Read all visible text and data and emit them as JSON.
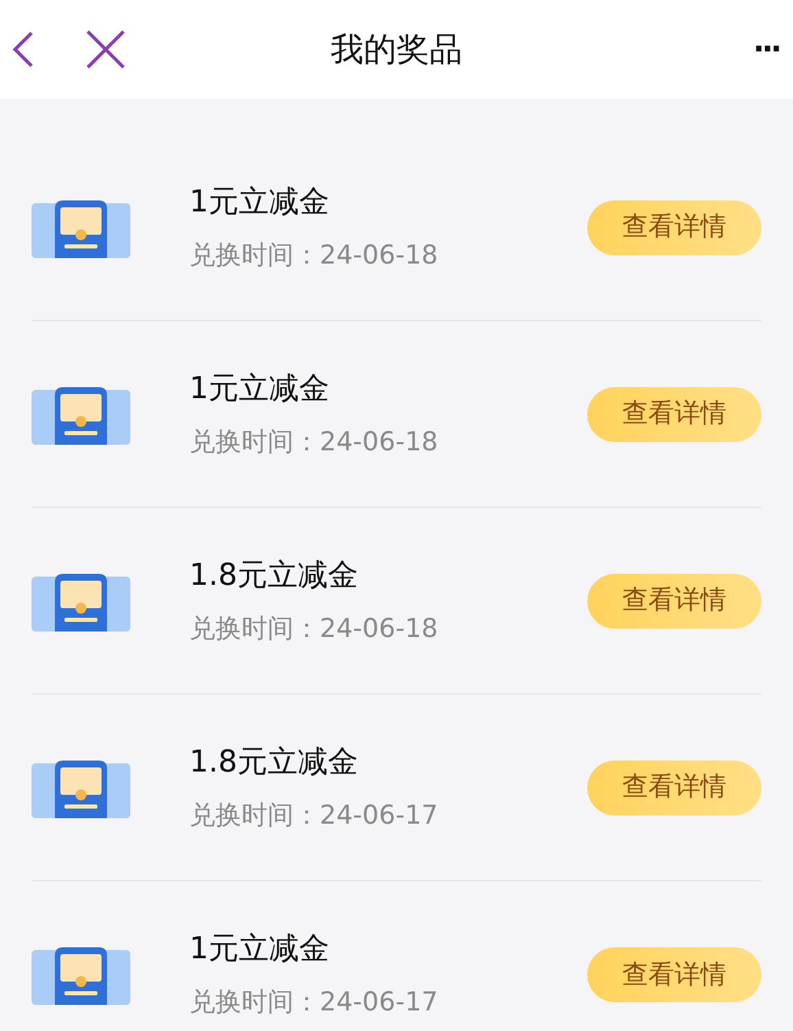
{
  "header": {
    "title": "我的奖品",
    "more": "···"
  },
  "prizes": [
    {
      "title": "1元立减金",
      "subtitle": "兑换时间：24-06-18",
      "button": "查看详情"
    },
    {
      "title": "1元立减金",
      "subtitle": "兑换时间：24-06-18",
      "button": "查看详情"
    },
    {
      "title": "1.8元立减金",
      "subtitle": "兑换时间：24-06-18",
      "button": "查看详情"
    },
    {
      "title": "1.8元立减金",
      "subtitle": "兑换时间：24-06-17",
      "button": "查看详情"
    },
    {
      "title": "1元立减金",
      "subtitle": "兑换时间：24-06-17",
      "button": "查看详情"
    }
  ]
}
